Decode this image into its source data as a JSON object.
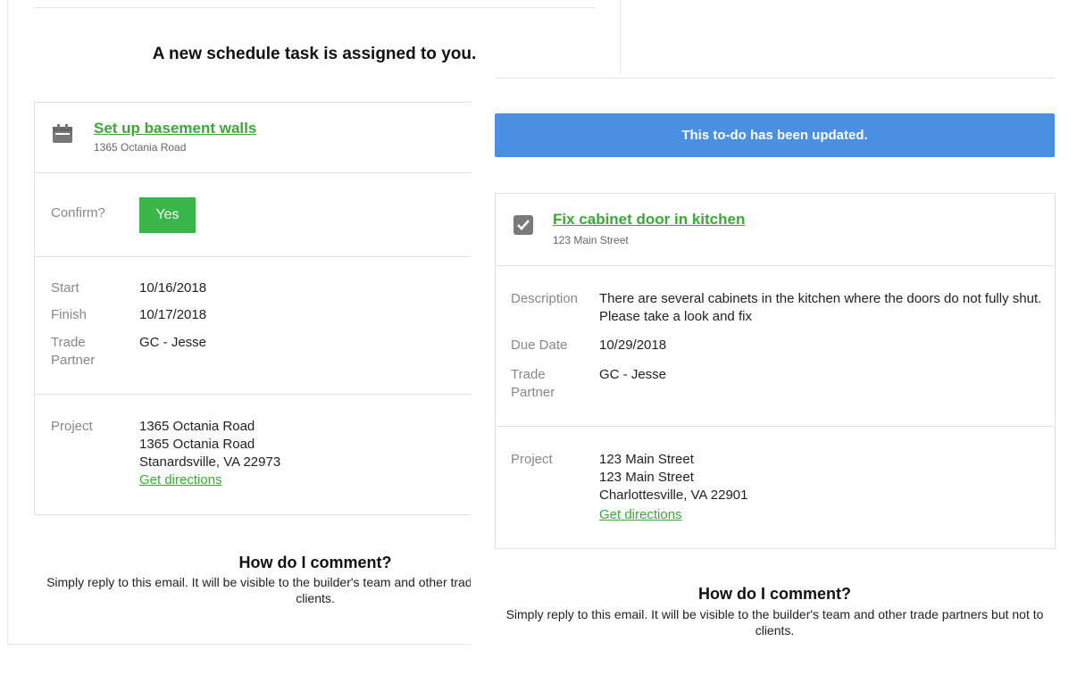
{
  "left_email": {
    "heading": "A new schedule task is assigned to you.",
    "task": {
      "title": "Set up basement walls",
      "subtitle": "1365 Octania Road",
      "icon": "calendar-icon"
    },
    "confirm": {
      "label": "Confirm?",
      "button": "Yes"
    },
    "dates": [
      {
        "label": "Start",
        "value": "10/16/2018"
      },
      {
        "label": "Finish",
        "value": "10/17/2018"
      },
      {
        "label": "Trade Partner",
        "value": "GC - Jesse"
      }
    ],
    "project": {
      "label": "Project",
      "line1": "1365 Octania Road",
      "line2": "1365 Octania Road",
      "line3": "Stanardsville, VA 22973",
      "directions": "Get directions"
    },
    "comment": {
      "heading": "How do I comment?",
      "body": "Simply reply to this email. It will be visible to the builder's team and other trade partners but not to clients."
    }
  },
  "right_email": {
    "banner": "This to-do has been updated.",
    "banner_color": "#4a90e2",
    "todo": {
      "title": "Fix cabinet door in kitchen",
      "subtitle": "123 Main Street",
      "icon": "checkbox-checked-icon"
    },
    "details": [
      {
        "label": "Description",
        "value": "There are several cabinets in the kitchen where the doors do not fully shut. Please take a look and fix"
      },
      {
        "label": "Due Date",
        "value": "10/29/2018"
      },
      {
        "label": "Trade Partner",
        "value": "GC - Jesse"
      }
    ],
    "project": {
      "label": "Project",
      "line1": "123 Main Street",
      "line2": "123 Main Street",
      "line3": "Charlottesville, VA 22901",
      "directions": "Get directions"
    },
    "comment": {
      "heading": "How do I comment?",
      "body": "Simply reply to this email. It will be visible to the builder's team and other trade partners but not to clients."
    }
  },
  "colors": {
    "accent_green": "#3aaa35",
    "button_green": "#3ab54a",
    "banner_blue": "#4a90e2"
  }
}
